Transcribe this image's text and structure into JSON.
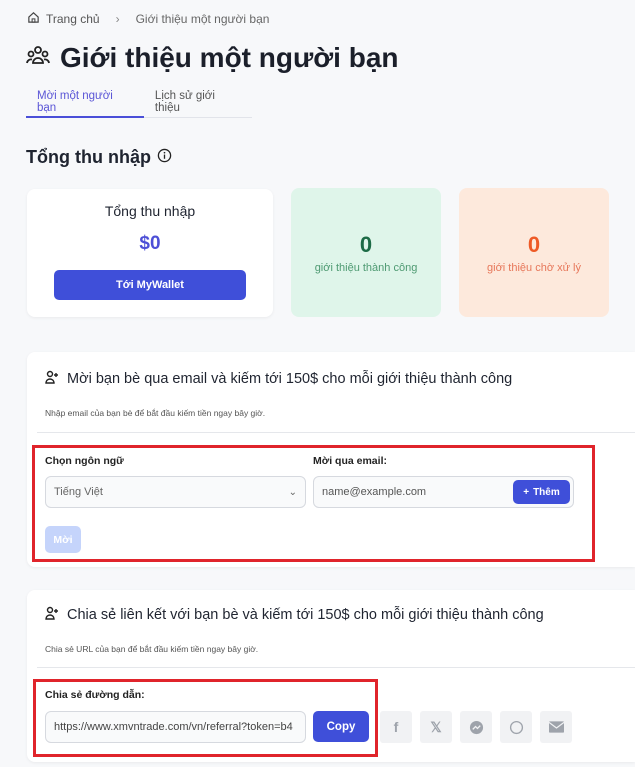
{
  "breadcrumb": {
    "home": "Trang chủ",
    "current": "Giới thiệu một người bạn"
  },
  "page_title": "Giới thiệu một người bạn",
  "tabs": [
    {
      "label": "Mời một người bạn",
      "active": true
    },
    {
      "label": "Lịch sử giới thiệu",
      "active": false
    }
  ],
  "earnings": {
    "heading": "Tổng thu nhập",
    "card_title": "Tổng thu nhập",
    "amount": "$0",
    "wallet_button": "Tới MyWallet"
  },
  "stats": [
    {
      "value": "0",
      "label": "giới thiệu thành công",
      "color": "#1c6b46"
    },
    {
      "value": "0",
      "label": "giới thiệu chờ xử lý",
      "color": "#ee5a26"
    }
  ],
  "invite": {
    "title": "Mời bạn bè qua email và kiếm tới 150$ cho mỗi giới thiệu thành công",
    "subtitle": "Nhập email của bạn bè để bắt đầu kiếm tiền ngay bây giờ.",
    "language_label": "Chọn ngôn ngữ",
    "language_value": "Tiếng Việt",
    "email_label": "Mời qua email:",
    "email_placeholder": "name@example.com",
    "add_button": "Thêm",
    "invite_button": "Mời"
  },
  "share": {
    "title": "Chia sẻ liên kết với bạn bè và kiếm tới 150$ cho mỗi giới thiệu thành công",
    "subtitle": "Chia sẻ URL của bạn để bắt đầu kiếm tiền ngay bây giờ.",
    "link_label": "Chia sẻ đường dẫn:",
    "link_value": "https://www.xmvntrade.com/vn/referral?token=b4",
    "copy_button": "Copy",
    "networks": [
      "facebook-icon",
      "x-icon",
      "messenger-icon",
      "whatsapp-icon",
      "email-icon"
    ]
  },
  "colors": {
    "accent": "#3f4fd9",
    "highlight": "#e0242b"
  }
}
